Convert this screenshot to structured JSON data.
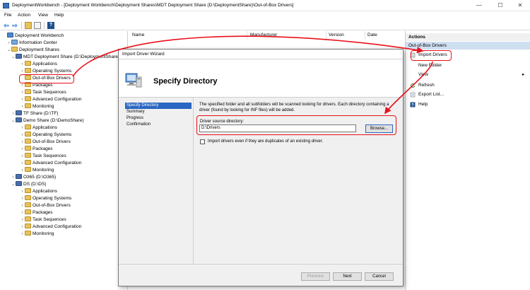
{
  "window": {
    "title": "DeploymentWorkbench - [Deployment Workbench\\Deployment Shares\\MDT Deployment Share (D:\\DeploymentShare)\\Out-of-Box Drivers]",
    "min_glyph": "—",
    "max_glyph": "☐",
    "close_glyph": "✕"
  },
  "menu": {
    "file": "File",
    "action": "Action",
    "view": "View",
    "help": "Help"
  },
  "toolbar": {
    "back_glyph": "⇦",
    "forward_glyph": "⇨",
    "help_glyph": "?"
  },
  "tree": {
    "items": [
      {
        "label": "Deployment Workbench",
        "chevron": "",
        "icon": "wb"
      },
      {
        "label": "Information Center",
        "chevron": "›",
        "icon": "info"
      },
      {
        "label": "Deployment Shares",
        "chevron": "⌄",
        "icon": "folder"
      },
      {
        "label": "MDT Deployment Share (D:\\DeploymentShare)",
        "chevron": "⌄",
        "icon": "share"
      },
      {
        "label": "Applications",
        "chevron": "›",
        "icon": "folder"
      },
      {
        "label": "Operating Systems",
        "chevron": "›",
        "icon": "folder"
      },
      {
        "label": "Out-of-Box Drivers",
        "chevron": "",
        "icon": "folder"
      },
      {
        "label": "Packages",
        "chevron": "›",
        "icon": "folder"
      },
      {
        "label": "Task Sequences",
        "chevron": "›",
        "icon": "folder"
      },
      {
        "label": "Advanced Configuration",
        "chevron": "›",
        "icon": "folder"
      },
      {
        "label": "Monitoring",
        "chevron": "›",
        "icon": "folder"
      },
      {
        "label": "TF Share (D:\\TF)",
        "chevron": "›",
        "icon": "share"
      },
      {
        "label": "Demo Share (D:\\DemoShare)",
        "chevron": "⌄",
        "icon": "share"
      },
      {
        "label": "Applications",
        "chevron": "›",
        "icon": "folder"
      },
      {
        "label": "Operating Systems",
        "chevron": "›",
        "icon": "folder"
      },
      {
        "label": "Out-of-Box Drivers",
        "chevron": "›",
        "icon": "folder"
      },
      {
        "label": "Packages",
        "chevron": "›",
        "icon": "folder"
      },
      {
        "label": "Task Sequences",
        "chevron": "›",
        "icon": "folder"
      },
      {
        "label": "Advanced Configuration",
        "chevron": "›",
        "icon": "folder"
      },
      {
        "label": "Monitoring",
        "chevron": "›",
        "icon": "folder"
      },
      {
        "label": "O365 (D:\\O365)",
        "chevron": "›",
        "icon": "share"
      },
      {
        "label": "DS (D:\\DS)",
        "chevron": "⌄",
        "icon": "share"
      },
      {
        "label": "Applications",
        "chevron": "›",
        "icon": "folder"
      },
      {
        "label": "Operating Systems",
        "chevron": "›",
        "icon": "folder"
      },
      {
        "label": "Out-of-Box Drivers",
        "chevron": "›",
        "icon": "folder"
      },
      {
        "label": "Packages",
        "chevron": "›",
        "icon": "folder"
      },
      {
        "label": "Task Sequences",
        "chevron": "›",
        "icon": "folder"
      },
      {
        "label": "Advanced Configuration",
        "chevron": "›",
        "icon": "folder"
      },
      {
        "label": "Monitoring",
        "chevron": "›",
        "icon": "folder"
      }
    ]
  },
  "list": {
    "columns": [
      "Name",
      "Manufacturer",
      "Version",
      "Date"
    ]
  },
  "actions": {
    "header": "Actions",
    "section": "Out-of-Box Drivers",
    "items": [
      "Import Drivers",
      "New Folder",
      "View",
      "Refresh",
      "Export List...",
      "Help"
    ],
    "view_arrow": "▸"
  },
  "dialog": {
    "title": "Import Driver Wizard",
    "heading": "Specify Directory",
    "nav": [
      "Specify Directory",
      "Summary",
      "Progress",
      "Confirmation"
    ],
    "description": "The specified folder and all subfolders will be scanned looking for drivers.  Each directory containing a driver (found by looking for INF files) will be added.",
    "source_label": "Driver source directory:",
    "source_value": "D:\\Drivers",
    "browse_label": "Browse...",
    "duplicates_label": "Import drivers even if they are duplicates of an existing driver.",
    "previous_label": "Previous",
    "next_label": "Next",
    "cancel_label": "Cancel"
  },
  "colors": {
    "annotation": "#e8101a",
    "selection": "#2a66c2",
    "actions_section_bg": "#cfdff2"
  }
}
